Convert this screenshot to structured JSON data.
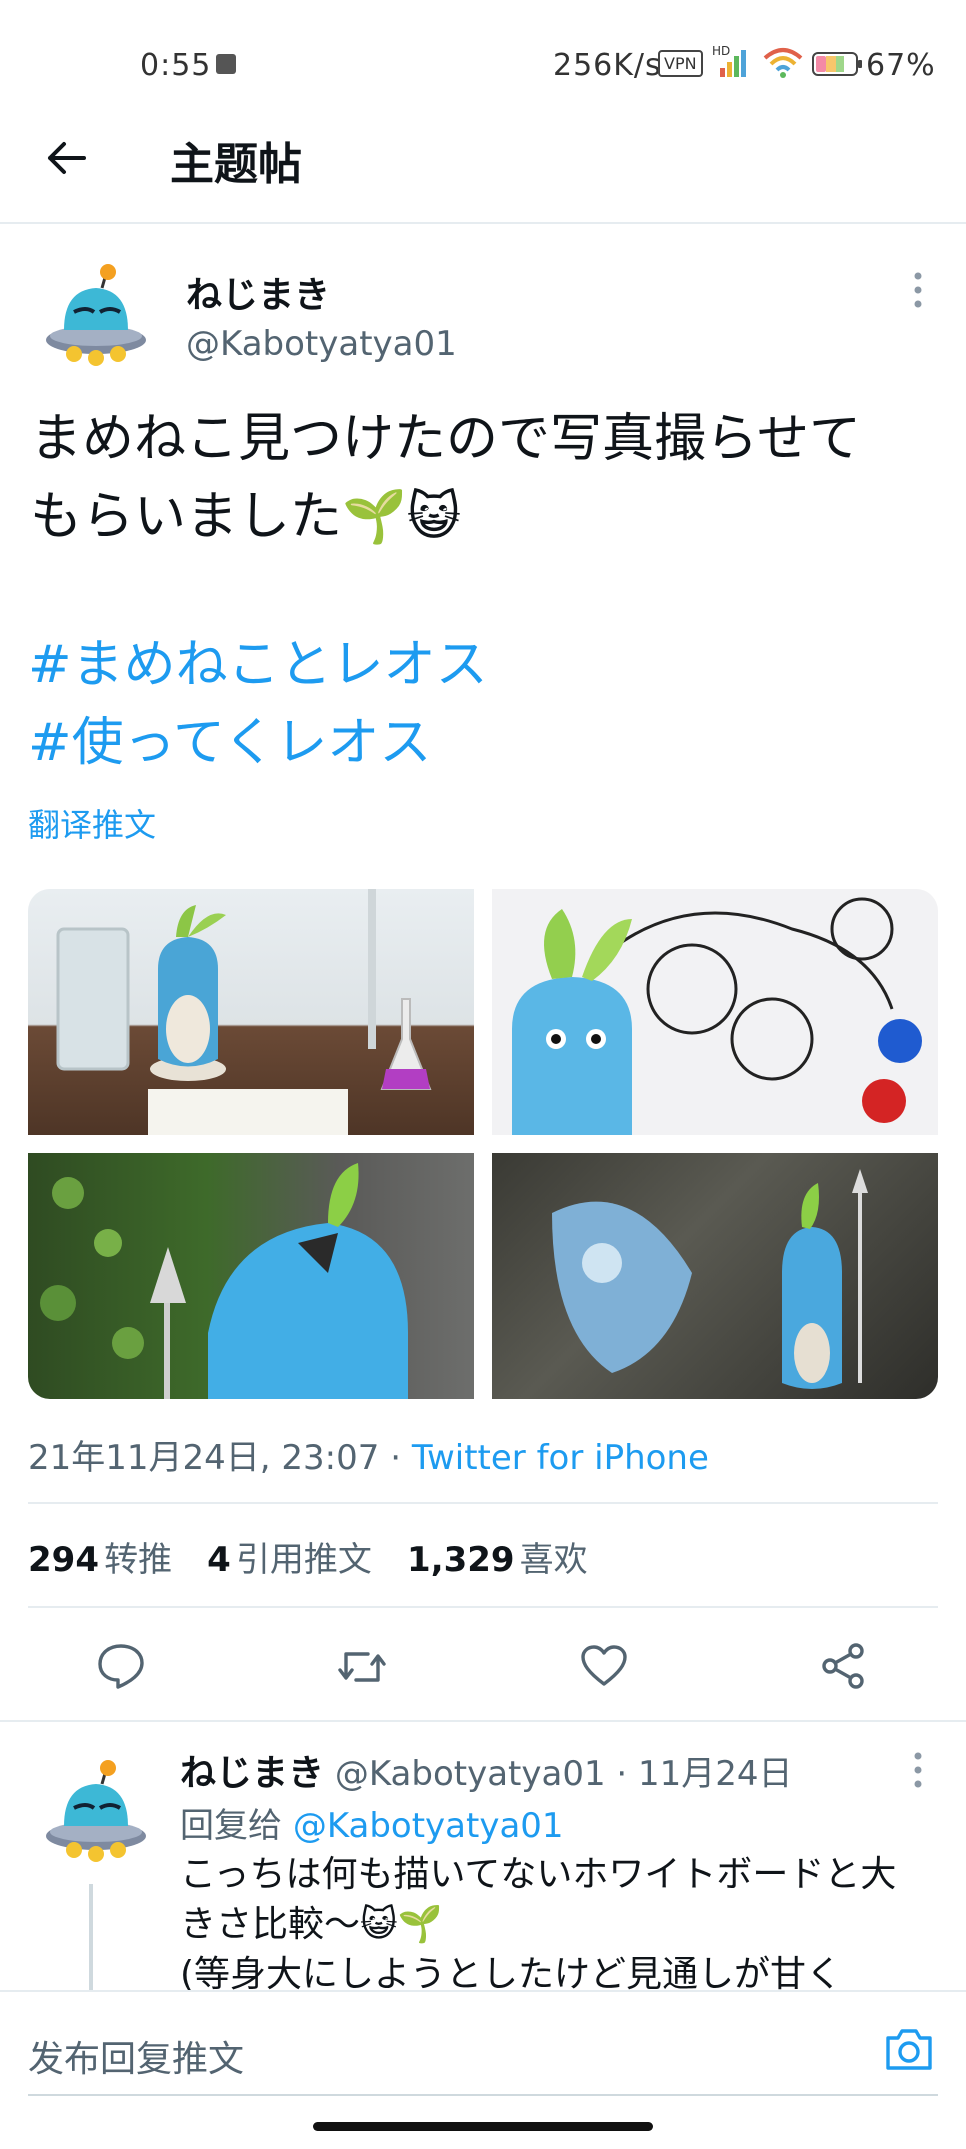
{
  "status_bar": {
    "time": "0:55",
    "network_speed": "256K/s",
    "vpn": "VPN",
    "hd": "HD",
    "battery": "67%"
  },
  "header": {
    "title": "主题帖"
  },
  "tweet": {
    "author_name": "ねじまき",
    "author_handle": "@Kabotyatya01",
    "text_line1": "まめねこ見つけたので写真撮らせて",
    "text_line2": "もらいました🌱😺",
    "hashtag1": "#まめねことレオス",
    "hashtag2": "#使ってくレオス",
    "translate_label": "翻译推文",
    "timestamp": "21年11月24日, 23:07 · ",
    "source": "Twitter for iPhone",
    "retweets_count": "294",
    "retweets_label": "转推",
    "quotes_count": "4",
    "quotes_label": "引用推文",
    "likes_count": "1,329",
    "likes_label": "喜欢"
  },
  "reply": {
    "author_name": "ねじまき",
    "author_handle": "@Kabotyatya01",
    "date": "· 11月24日",
    "replying_to_label": "回复给",
    "replying_to_handle": "@Kabotyatya01",
    "text_line1": "こっちは何も描いてないホワイトボードと大",
    "text_line2": "きさ比較〜😺🌱",
    "text_line3": "(等身大にしようとしたけど見通しが甘く"
  },
  "composer": {
    "placeholder": "发布回复推文"
  },
  "colors": {
    "accent": "#1d9bf0",
    "secondary_text": "#536471",
    "divider": "#e6ecf0"
  }
}
